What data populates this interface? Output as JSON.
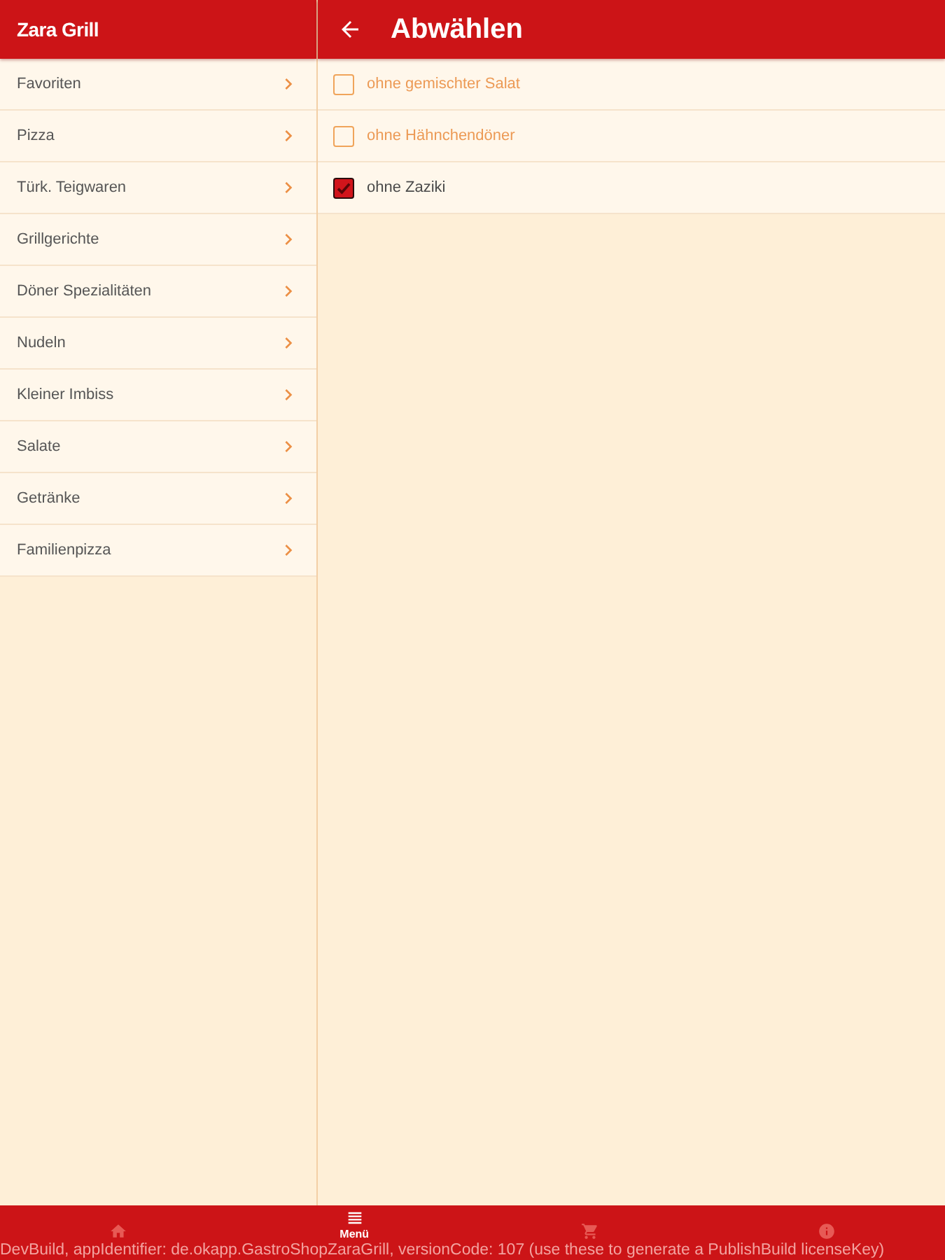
{
  "sidebar": {
    "title": "Zara Grill",
    "items": [
      {
        "label": "Favoriten"
      },
      {
        "label": "Pizza"
      },
      {
        "label": "Türk. Teigwaren"
      },
      {
        "label": "Grillgerichte"
      },
      {
        "label": "Döner Spezialitäten"
      },
      {
        "label": "Nudeln"
      },
      {
        "label": "Kleiner Imbiss"
      },
      {
        "label": "Salate"
      },
      {
        "label": "Getränke"
      },
      {
        "label": "Familienpizza"
      }
    ]
  },
  "detail": {
    "title": "Abwählen",
    "options": [
      {
        "label": "ohne gemischter Salat",
        "checked": false
      },
      {
        "label": "ohne Hähnchendöner",
        "checked": false
      },
      {
        "label": "ohne Zaziki",
        "checked": true
      }
    ]
  },
  "bottom_nav": {
    "tabs": [
      {
        "kind": "home",
        "selected": false
      },
      {
        "kind": "menu",
        "label": "Menü",
        "selected": true
      },
      {
        "kind": "cart",
        "selected": false
      },
      {
        "kind": "info",
        "selected": false
      }
    ]
  },
  "dev_notice": "DevBuild, appIdentifier: de.okapp.GastroShopZaraGrill, versionCode: 107 (use these to generate a PublishBuild licenseKey)"
}
